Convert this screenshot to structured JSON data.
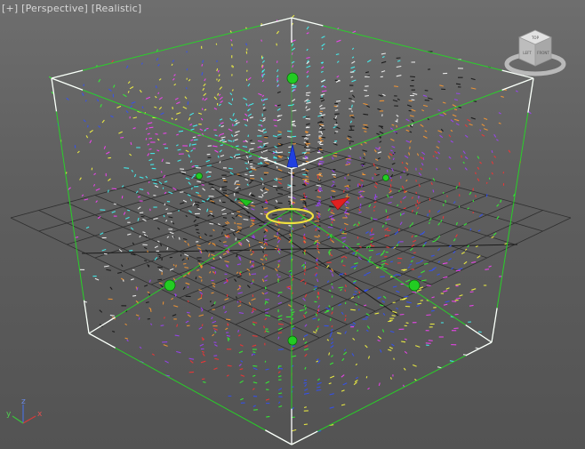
{
  "viewport": {
    "label_plus": "[+]",
    "label_view": "[Perspective]",
    "label_shading": "[Realistic]"
  },
  "viewcube": {
    "face_top": "TOP",
    "face_left": "LEFT",
    "face_front": "FRONT",
    "icon": "viewcube-icon"
  },
  "axis_tripod": {
    "x_label": "x",
    "y_label": "y",
    "z_label": "z",
    "x_color": "#d63a3a",
    "y_color": "#3ac23a",
    "z_color": "#4a6ed8"
  },
  "colors": {
    "background_top": "#6e6e6e",
    "background_bottom": "#535353",
    "grid": "#2e2e2e",
    "bounding_box": "#22dd22",
    "selection_brackets": "#ffffff",
    "gizmo_handle": "#22cc22",
    "particle_palette": [
      "#ff3030",
      "#30ff30",
      "#3050ff",
      "#ffff40",
      "#ff40ff",
      "#40ffff",
      "#ffffff",
      "#111111",
      "#ff9a30",
      "#a040ff"
    ]
  }
}
